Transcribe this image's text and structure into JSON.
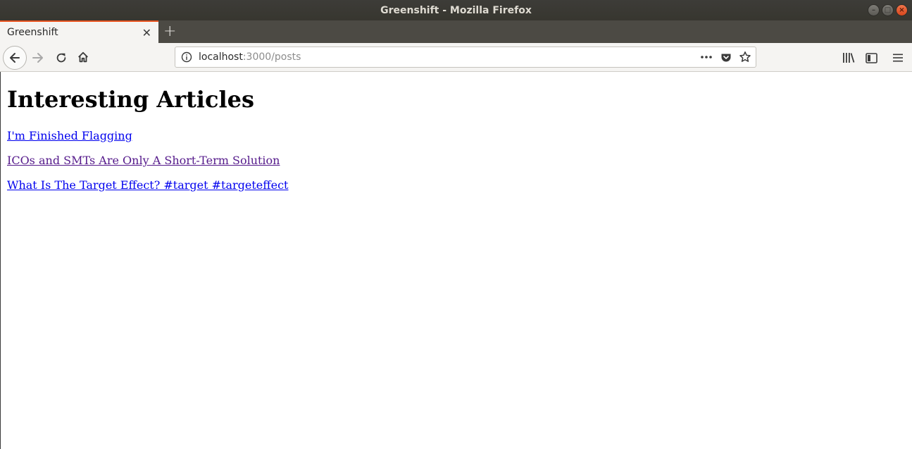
{
  "window": {
    "title": "Greenshift - Mozilla Firefox"
  },
  "tab": {
    "label": "Greenshift",
    "close_glyph": "✕",
    "new_tab_glyph": "+"
  },
  "navbar": {
    "url_host": "localhost",
    "url_path": ":3000/posts",
    "icons": [
      "back-icon",
      "forward-icon",
      "reload-icon",
      "home-icon",
      "info-icon",
      "more-icon",
      "pocket-icon",
      "bookmark-star-icon",
      "library-icon",
      "sidebar-icon",
      "menu-icon"
    ]
  },
  "page": {
    "heading": "Interesting Articles",
    "posts": [
      {
        "title": "I'm Finished Flagging",
        "visited": false
      },
      {
        "title": "ICOs and SMTs Are Only A Short-Term Solution",
        "visited": true
      },
      {
        "title": "What Is The Target Effect? #target #targeteffect",
        "visited": false
      }
    ]
  },
  "colors": {
    "accent": "#e95420",
    "link": "#0000ee",
    "visited_link": "#551a8b"
  }
}
